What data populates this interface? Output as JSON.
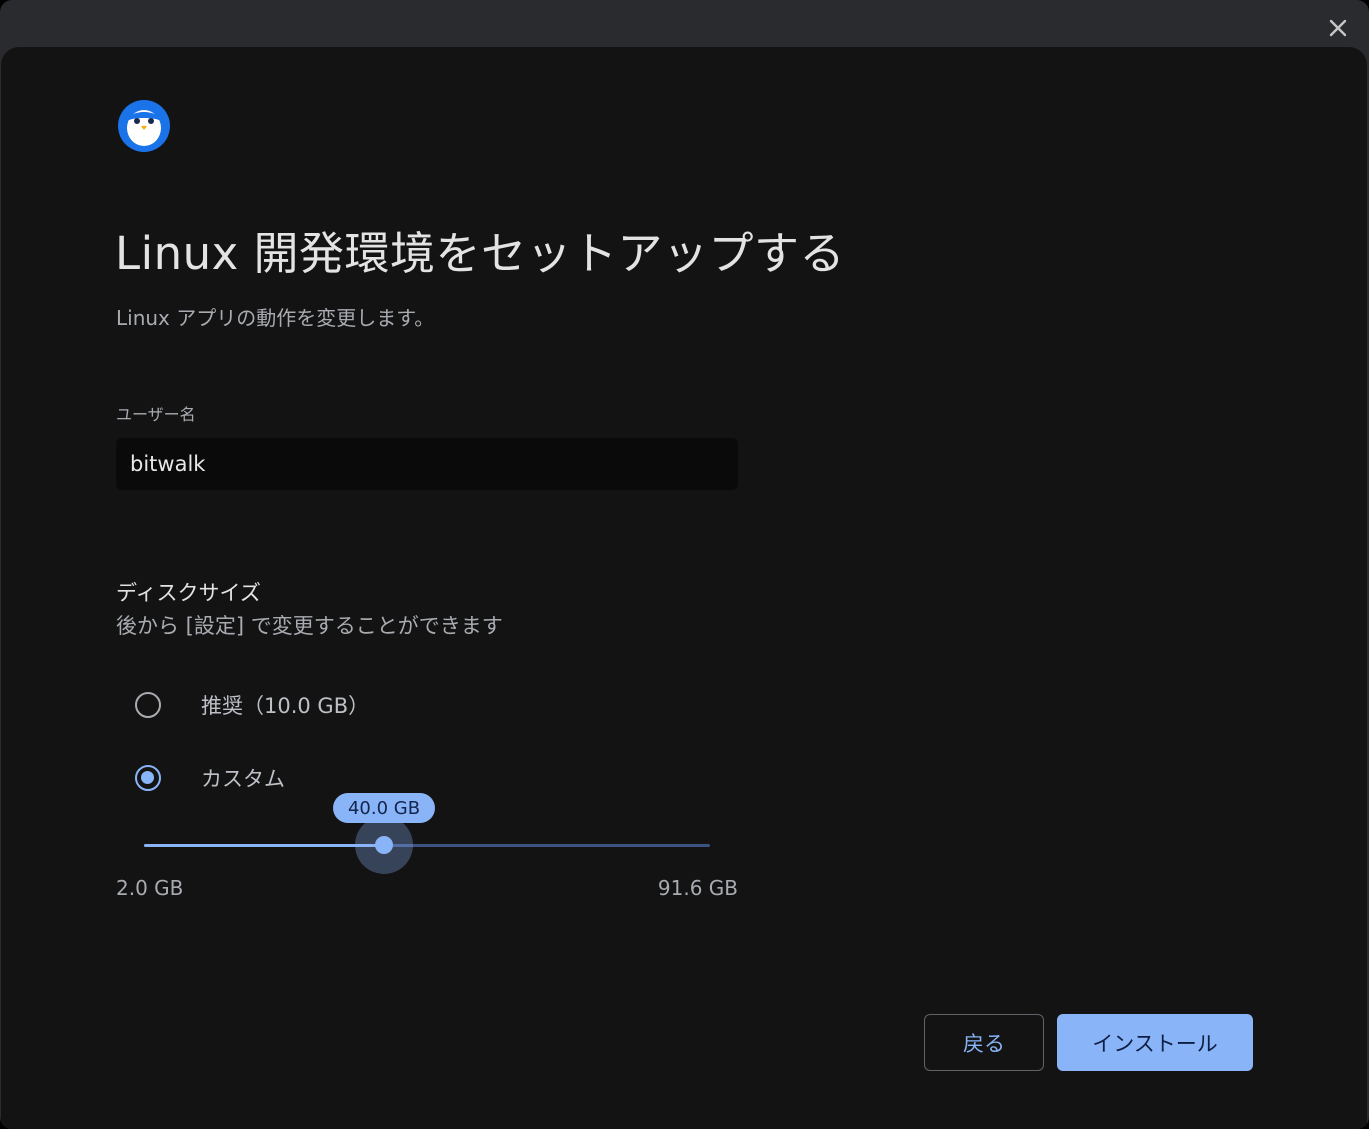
{
  "window": {
    "close_icon": "close-icon"
  },
  "header": {
    "logo_icon": "linux-penguin-icon",
    "title": "Linux 開発環境をセットアップする",
    "subtitle": "Linux アプリの動作を変更します。"
  },
  "username": {
    "label": "ユーザー名",
    "value": "bitwalk"
  },
  "disk": {
    "title": "ディスクサイズ",
    "description": "後から [設定] で変更することができます",
    "options": [
      {
        "label": "推奨（10.0 GB）",
        "selected": false
      },
      {
        "label": "カスタム",
        "selected": true
      }
    ],
    "slider": {
      "value_label": "40.0 GB",
      "value": 40.0,
      "min": 2.0,
      "max": 91.6,
      "min_label": "2.0 GB",
      "max_label": "91.6 GB"
    }
  },
  "buttons": {
    "back": "戻る",
    "install": "インストール"
  },
  "colors": {
    "accent": "#8ab4f8",
    "background": "#131314",
    "text_primary": "#e3e3e3",
    "text_secondary": "#a8abb0"
  }
}
